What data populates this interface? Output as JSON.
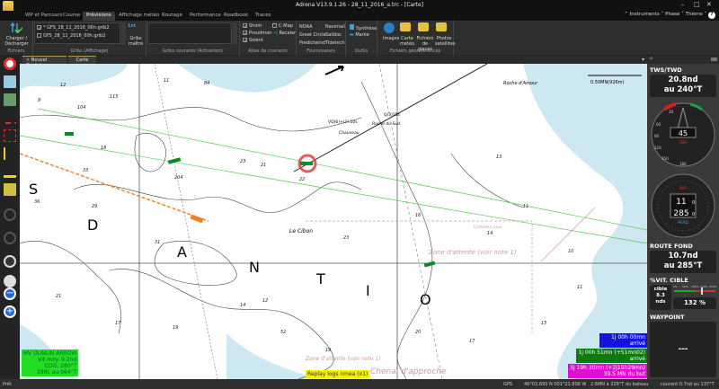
{
  "window": {
    "title": "Adrena V13.9.1.26 - 28_11_2016_a.trc - [Carte]",
    "minimize": "–",
    "maximize": "□",
    "close": "✕"
  },
  "tabs": [
    "WP et Parcours",
    "Course",
    "Prévisions",
    "Affichage météo",
    "Routage",
    "Performance",
    "Roadbook",
    "Traces"
  ],
  "active_tab": "Prévisions",
  "right_menu": {
    "instruments": "Instruments",
    "phase": "Phase",
    "theme": "Thème",
    "help": "?"
  },
  "ribbon": {
    "fichiers": {
      "button": "Charger / Décharger",
      "group": "Fichiers"
    },
    "gribs": {
      "files": [
        "* GFS_28_11_2016_06h.grib2",
        "GFS_28_11_2016_00h.grib2"
      ],
      "checked": [
        true,
        false
      ],
      "master_button": "Gribs maître",
      "master_badge": "1st",
      "group": "Gribs (Affichage)"
    },
    "gribs_courants": {
      "group": "Gribs courants (Activation)"
    },
    "atlas": {
      "items": [
        {
          "label": "Shom",
          "checked": true
        },
        {
          "label": "Proudman",
          "checked": true
        },
        {
          "label": "Solent",
          "checked": true
        },
        {
          "label": "C-Map",
          "checked": false
        }
      ],
      "recaler": "Recaler",
      "group": "Atlas de courants"
    },
    "fournisseurs": {
      "items": [
        "NOAA",
        "Navimail",
        "Great Circle",
        "Saildoc",
        "Predictwind",
        "Tidetech"
      ],
      "group": "Fournisseurs"
    },
    "outils": {
      "items": [
        "Synthèse",
        "Marée"
      ],
      "group": "Outils"
    },
    "geo": {
      "items": [
        "Images",
        "Carte météo",
        "Fichiers de glaces",
        "Photos satellites"
      ],
      "group": "Fichiers géoréférencés"
    }
  },
  "doc_tabs": [
    "Nouvel Onglet",
    "Carte"
  ],
  "map": {
    "scale": "0.50MN(926m)",
    "labels": [
      "Zone d'attente (voir note 1)",
      "Le Cibon",
      "S",
      "D",
      "A",
      "N",
      "T",
      "I",
      "O",
      "Chenal d'approche",
      "Zone d'attente (voir note 1)",
      "Roche d'Amour",
      "Chauveau",
      "Roche du Sud",
      "VQ(6)+LFl.10s",
      "Q(3)15s",
      "Collecteur eaux"
    ],
    "soundings": [
      "12",
      "84",
      "104",
      "115",
      "9",
      "11",
      "18",
      "33",
      "204",
      "21",
      "22",
      "23",
      "36",
      "29",
      "31",
      "21",
      "17",
      "19",
      "14",
      "13",
      "11",
      "12",
      "10",
      "14",
      "16",
      "52",
      "19",
      "20",
      "17",
      "15",
      "11",
      "23"
    ],
    "overlays": {
      "boat": {
        "name": "MV DUNLIN ARROW",
        "lines": [
          "Vit moy. 9.2nd",
          "COG: 280°T",
          "299L au 064°T"
        ],
        "color": "#22dd22"
      },
      "replay": {
        "text": "Replay logs nmea (x1)",
        "color": "#f4f000"
      },
      "eta": [
        {
          "lines": [
            "1j 00h 00mn",
            "arrivé"
          ],
          "color": "#1414e0"
        },
        {
          "lines": [
            "1j 00h 51mn (+51mn02)",
            "arrivé"
          ],
          "color": "#0c7a0c"
        },
        {
          "lines": [
            "3j 19h 30mn (+2j19h29mn)",
            "39.5 MN du but"
          ],
          "color": "#e010d0"
        }
      ]
    }
  },
  "panel": {
    "tws_title": "TWS/TWD",
    "tws_line1": "20.8nd",
    "tws_line2": "au 240°T",
    "gauge1": {
      "value": "45",
      "unit": "kt",
      "ticks": [
        "30",
        "60",
        "90",
        "120",
        "150",
        "180"
      ],
      "label": "TWA"
    },
    "gauge2": {
      "top": "11",
      "top_dec": "0",
      "bottom": "285",
      "bottom_dec": "0",
      "label_top": "BSP",
      "label_bottom": "HEAD"
    },
    "route_title": "ROUTE FOND",
    "route_line1": "10.7nd",
    "route_line2": "au 285°T",
    "vit_title": "%VIT. CIBLE",
    "cible_lines": [
      "cible",
      "8.3",
      "nds"
    ],
    "scale_labels": [
      "0%",
      "50%",
      "100%",
      "150%",
      "200%"
    ],
    "percent": "132 %",
    "percent_value": 132,
    "waypoint_title": "WAYPOINT",
    "waypoint_value": "---"
  },
  "status": {
    "left": "Prêt",
    "gps": "GPS",
    "position": "46°03.693 N  001°21.806 W",
    "bearing": "2.6MN à 228°T du bateau",
    "current": "courant 0.7nd au 137°T"
  }
}
